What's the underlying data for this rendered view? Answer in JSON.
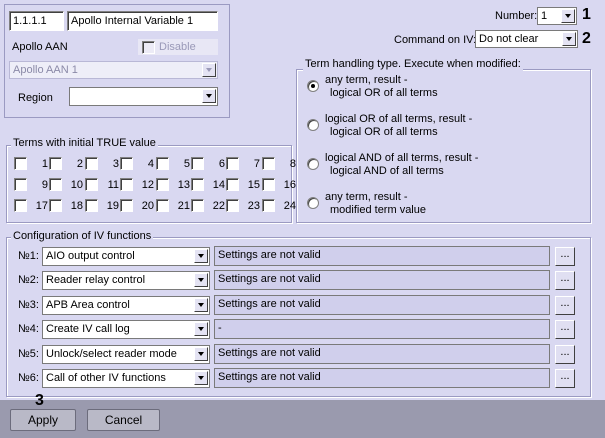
{
  "object": {
    "id": "1.1.1.1",
    "name": "Apollo Internal Variable 1",
    "aan_label": "Apollo AAN",
    "disable_label": "Disable",
    "aan_value": "Apollo AAN 1",
    "region_label": "Region",
    "region_value": ""
  },
  "header": {
    "number_label": "Number:",
    "number_value": "1",
    "command_label": "Command on IV:",
    "command_value": "Do not clear"
  },
  "callouts": {
    "c1": "1",
    "c2": "2",
    "c3": "3"
  },
  "terms": {
    "title": "Terms with initial TRUE value",
    "items": [
      "1",
      "2",
      "3",
      "4",
      "5",
      "6",
      "7",
      "8",
      "9",
      "10",
      "11",
      "12",
      "13",
      "14",
      "15",
      "16",
      "17",
      "18",
      "19",
      "20",
      "21",
      "22",
      "23",
      "24"
    ]
  },
  "handling": {
    "title": "Term handling type. Execute when modified:",
    "options": [
      {
        "line1": "any term, result -",
        "line2": "logical OR of all terms",
        "checked": true
      },
      {
        "line1": "logical OR of all terms, result -",
        "line2": "logical OR of all terms",
        "checked": false
      },
      {
        "line1": "logical AND of all terms, result -",
        "line2": "logical AND of all terms",
        "checked": false
      },
      {
        "line1": "any term, result -",
        "line2": "modified term value",
        "checked": false
      }
    ]
  },
  "functions": {
    "title": "Configuration of IV functions",
    "rows": [
      {
        "label": "№1:",
        "function": "AIO output control",
        "settings": "Settings are not valid",
        "more": "..."
      },
      {
        "label": "№2:",
        "function": "Reader relay control",
        "settings": "Settings are not valid",
        "more": "..."
      },
      {
        "label": "№3:",
        "function": "APB Area control",
        "settings": "Settings are not valid",
        "more": "..."
      },
      {
        "label": "№4:",
        "function": "Create IV call log",
        "settings": "-",
        "more": "..."
      },
      {
        "label": "№5:",
        "function": "Unlock/select reader mode",
        "settings": "Settings are not valid",
        "more": "..."
      },
      {
        "label": "№6:",
        "function": "Call of other IV functions",
        "settings": "Settings are not valid",
        "more": "..."
      }
    ]
  },
  "footer": {
    "apply_label": "Apply",
    "cancel_label": "Cancel"
  }
}
